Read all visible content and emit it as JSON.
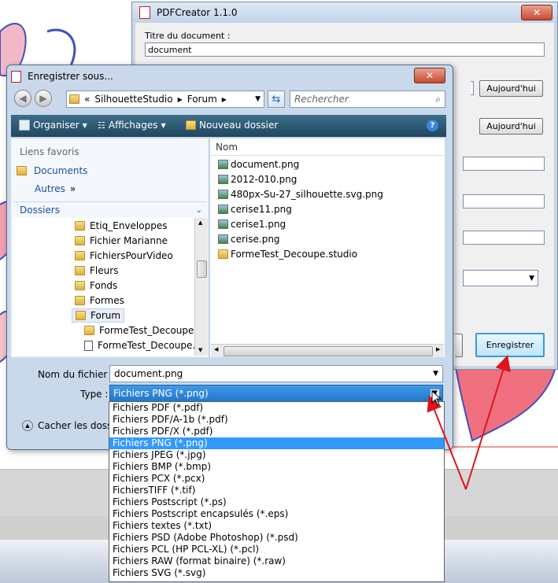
{
  "pdfcreator": {
    "title": "PDFCreator 1.1.0",
    "doc_title_label": "Titre du document :",
    "doc_title_value": "document",
    "today_button_1": "Aujourd'hui",
    "today_button_2": "Aujourd'hui",
    "save_button": "Enregistrer"
  },
  "save_dialog": {
    "title": "Enregistrer sous...",
    "breadcrumb": [
      "SilhouetteStudio",
      "Forum"
    ],
    "search_placeholder": "Rechercher",
    "toolbar": {
      "organize": "Organiser",
      "views": "Affichages",
      "new_folder": "Nouveau dossier"
    },
    "favorites_header": "Liens favoris",
    "favorites": [
      "Documents",
      "Autres"
    ],
    "folders_header": "Dossiers",
    "folders": [
      "Etiq_Enveloppes",
      "Fichier Marianne",
      "FichiersPourVideo",
      "Fleurs",
      "Fonds",
      "Formes",
      "Forum"
    ],
    "subfolders": [
      "FormeTest_Decoupe.st",
      "FormeTest_Decoupe.st"
    ],
    "column_name": "Nom",
    "files": [
      "document.png",
      "2012-010.png",
      "480px-Su-27_silhouette.svg.png",
      "cerise11.png",
      "cerise1.png",
      "cerise.png",
      "FormeTest_Decoupe.studio"
    ],
    "filename_label": "Nom du fichier :",
    "filename_value": "document.png",
    "type_label": "Type :",
    "type_value": "Fichiers PNG (*.png)",
    "hide_folders": "Cacher les dossiers",
    "type_options": [
      "Fichiers PDF (*.pdf)",
      "Fichiers PDF/A-1b (*.pdf)",
      "Fichiers PDF/X (*.pdf)",
      "Fichiers PNG (*.png)",
      "Fichiers JPEG (*.jpg)",
      "Fichiers BMP (*.bmp)",
      "Fichiers PCX (*.pcx)",
      "FichiersTIFF (*.tif)",
      "Fichiers Postscript (*.ps)",
      "Fichiers Postscript encapsulés (*.eps)",
      "Fichiers textes (*.txt)",
      "Fichiers PSD (Adobe Photoshop) (*.psd)",
      "Fichiers PCL (HP PCL-XL) (*.pcl)",
      "Fichiers RAW (format binaire) (*.raw)",
      "Fichiers SVG (*.svg)"
    ],
    "selected_type_index": 3
  },
  "colors": {
    "accent_selection": "#3399ff",
    "toolbar": "#2b5a74",
    "annotation_arrow": "#e0141a"
  }
}
